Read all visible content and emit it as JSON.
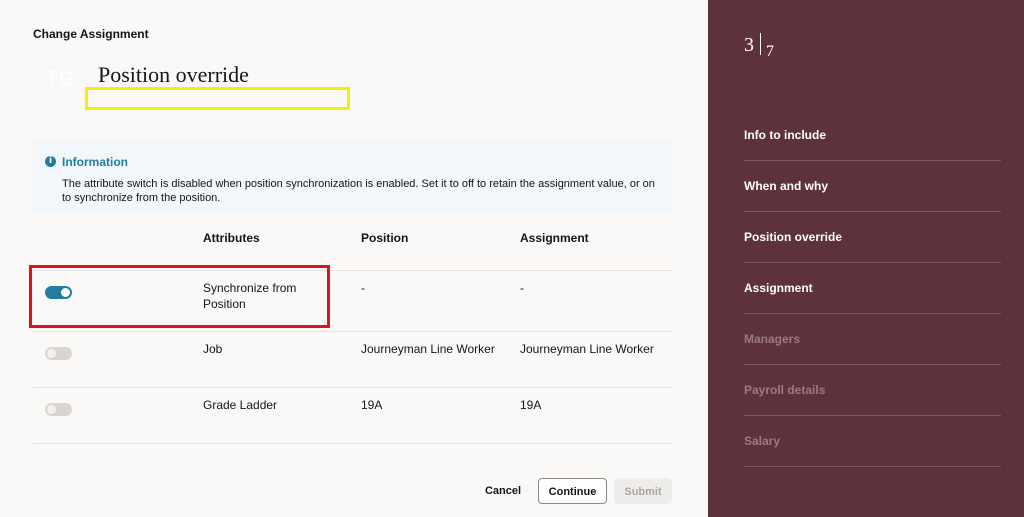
{
  "header": {
    "title": "Change Assignment"
  },
  "avatar": {
    "initials": "TG"
  },
  "page": {
    "title": "Position override"
  },
  "info": {
    "title": "Information",
    "text": "The attribute switch is disabled when position synchronization is enabled. Set it to off to retain the assignment value, or on to synchronize from the position."
  },
  "table": {
    "columns": [
      "Attributes",
      "Position",
      "Assignment"
    ],
    "rows": [
      {
        "toggle": "on",
        "attribute": "Synchronize from Position",
        "position": "-",
        "assignment": "-"
      },
      {
        "toggle": "off",
        "attribute": "Job",
        "position": "Journeyman Line Worker",
        "assignment": "Journeyman Line Worker"
      },
      {
        "toggle": "off",
        "attribute": "Grade Ladder",
        "position": "19A",
        "assignment": "19A"
      }
    ]
  },
  "footer": {
    "cancel": "Cancel",
    "continue": "Continue",
    "submit": "Submit"
  },
  "train": {
    "current": "3",
    "total": "7",
    "steps": [
      {
        "label": "Info to include",
        "state": "visited"
      },
      {
        "label": "When and why",
        "state": "visited"
      },
      {
        "label": "Position override",
        "state": "current"
      },
      {
        "label": "Assignment",
        "state": "visited"
      },
      {
        "label": "Managers",
        "state": "disabled"
      },
      {
        "label": "Payroll details",
        "state": "disabled"
      },
      {
        "label": "Salary",
        "state": "disabled"
      }
    ]
  },
  "colors": {
    "sidebar": "#5d323b",
    "accent": "#227e9e",
    "highlight_yellow": "#f5f000",
    "highlight_red": "#e0141e"
  }
}
